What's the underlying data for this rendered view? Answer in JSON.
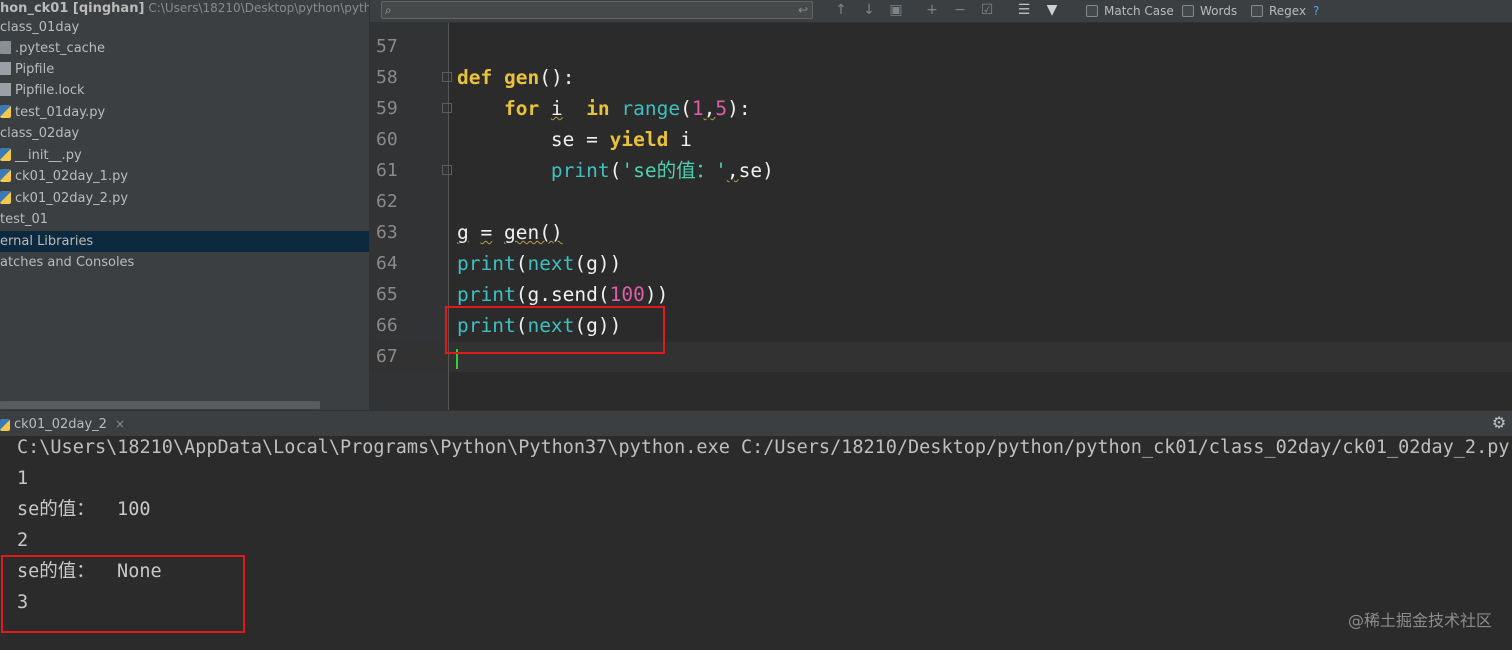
{
  "project": {
    "root_name": "hon_ck01 [qinghan]",
    "root_path": "C:\\Users\\18210\\Desktop\\python\\pyth",
    "items": [
      {
        "label": "class_01day",
        "icon": "none"
      },
      {
        "label": ".pytest_cache",
        "icon": "folder-icon"
      },
      {
        "label": "Pipfile",
        "icon": "file-icon"
      },
      {
        "label": "Pipfile.lock",
        "icon": "file-icon"
      },
      {
        "label": "test_01day.py",
        "icon": "python-file-icon"
      },
      {
        "label": "class_02day",
        "icon": "none"
      },
      {
        "label": "__init__.py",
        "icon": "python-file-icon"
      },
      {
        "label": "ck01_02day_1.py",
        "icon": "python-file-icon"
      },
      {
        "label": "ck01_02day_2.py",
        "icon": "python-file-icon"
      },
      {
        "label": "test_01",
        "icon": "none"
      },
      {
        "label": "ernal Libraries",
        "icon": "none",
        "selected": true
      },
      {
        "label": "atches and Consoles",
        "icon": "none"
      }
    ]
  },
  "search": {
    "placeholder": "",
    "options": [
      "Match Case",
      "Words",
      "Regex"
    ],
    "help": "?"
  },
  "editor": {
    "line_numbers": [
      "57",
      "58",
      "59",
      "60",
      "61",
      "62",
      "63",
      "64",
      "65",
      "66",
      "67"
    ],
    "code": {
      "l58_def": "def",
      "l58_name": "gen",
      "l58_rest": "():",
      "l59_for": "for",
      "l59_i": "i",
      "l59_in": "in",
      "l59_range": "range",
      "l59_open": "(",
      "l59_n1": "1",
      "l59_comma": ",",
      "l59_n2": "5",
      "l59_close": "):",
      "l60_se": "se",
      "l60_eq": "=",
      "l60_yield": "yield",
      "l60_i": "i",
      "l61_print": "print",
      "l61_open": "(",
      "l61_str": "'se的值：'",
      "l61_comma": ",",
      "l61_se": "se",
      "l61_close": ")",
      "l63_g": "g",
      "l63_eq": "=",
      "l63_call": "gen()",
      "l64_print": "print",
      "l64_open": "(",
      "l64_next": "next",
      "l64_rest": "(g))",
      "l65_print": "print",
      "l65_open": "(",
      "l65_g": "g",
      "l65_send": ".send(",
      "l65_num": "100",
      "l65_close": "))",
      "l66_print": "print",
      "l66_open": "(",
      "l66_next": "next",
      "l66_rest": "(g))"
    }
  },
  "run": {
    "tab_label": "ck01_02day_2",
    "close": "×",
    "console_lines": [
      "C:\\Users\\18210\\AppData\\Local\\Programs\\Python\\Python37\\python.exe C:/Users/18210/Desktop/python/python_ck01/class_02day/ck01_02day_2.py",
      "1",
      "se的值：  100",
      "2",
      "se的值：  None",
      "3"
    ]
  },
  "watermark": "@稀土掘金技术社区",
  "colors": {
    "highlight_box": "#e01a1a",
    "selection": "#0d293e",
    "caret": "#32d13c"
  }
}
